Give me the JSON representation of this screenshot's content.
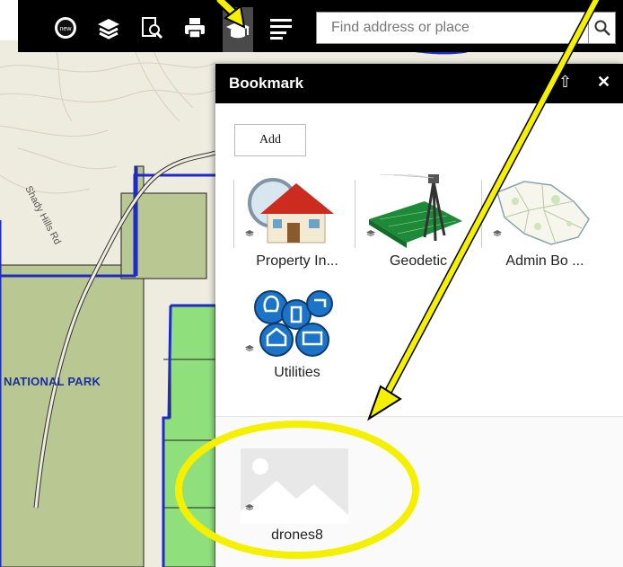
{
  "toolbar": {
    "icons": [
      "new-icon",
      "layers-icon",
      "query-icon",
      "print-icon",
      "bookmark-icon",
      "list-icon"
    ],
    "search_placeholder": "Find address or place",
    "search_value": ""
  },
  "map": {
    "park_label": "NATIONAL PARK",
    "road_label": "Shady Hills Rd"
  },
  "panel": {
    "title": "Bookmark",
    "add_label": "Add",
    "bookmarks": [
      {
        "label": "Property In...",
        "icon": "house-magnifier-icon"
      },
      {
        "label": "Geodetic",
        "icon": "survey-tripod-icon"
      },
      {
        "label": "Admin Bo ...",
        "icon": "admin-map-icon"
      },
      {
        "label": "Utilities",
        "icon": "utilities-icon"
      },
      {
        "label": "drones8",
        "icon": "image-placeholder-icon"
      }
    ]
  },
  "colors": {
    "toolbar_bg": "#000000",
    "annotation": "#f5f000",
    "park_fill": "#b9c792",
    "parcel_fill": "#8fe07d",
    "boundary": "#1f2bc8"
  }
}
